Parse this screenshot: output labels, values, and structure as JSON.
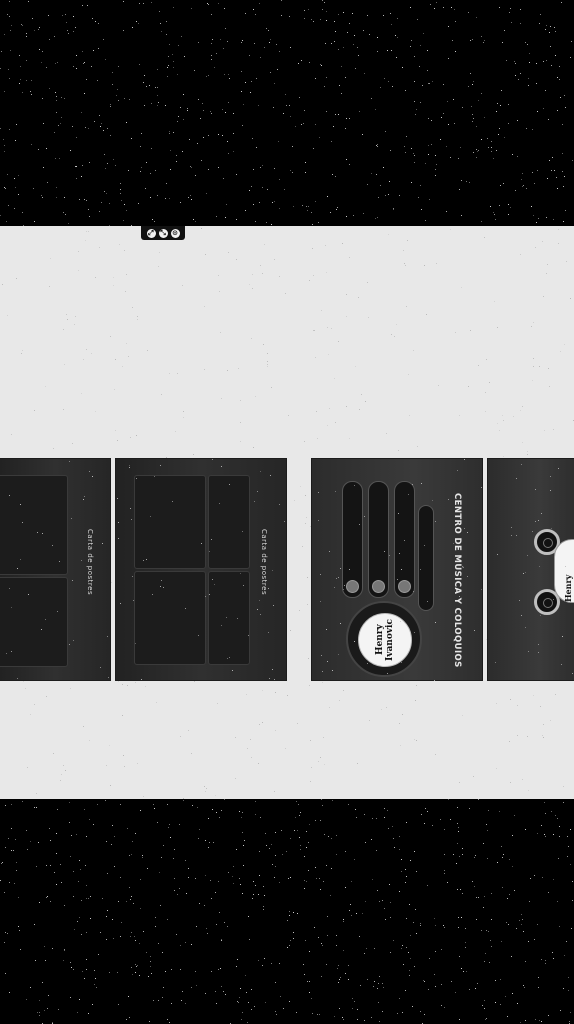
{
  "toolbar": {
    "buttons": [
      {
        "icon": "expand-icon",
        "glyph": "⤢"
      },
      {
        "icon": "shrink-icon",
        "glyph": "⤡"
      },
      {
        "icon": "close-icon",
        "glyph": "⊙"
      }
    ]
  },
  "pages": {
    "menu_left": {
      "title": "Carta de postres"
    },
    "menu_right": {
      "title": "Carta de postres"
    },
    "stereo": {
      "title": "CENTRO DE MÚSICA Y COLOQUIOS",
      "disc_label": "Henry Ivanovic"
    },
    "partial": {
      "disc_label": "Henry Ivanovic"
    }
  }
}
